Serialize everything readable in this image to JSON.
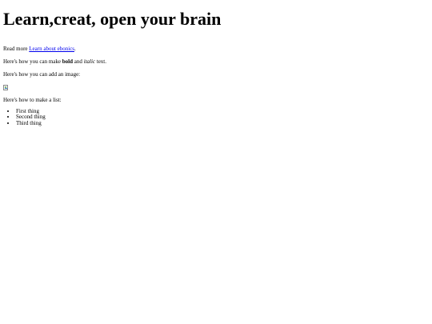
{
  "heading": "Learn,creat, open your brain",
  "read_more": {
    "prefix": "Read more ",
    "link_text": "Learn about ebonics",
    "suffix": "."
  },
  "formatting": {
    "prefix": "Here's how you can make ",
    "bold": "bold",
    "middle": " and ",
    "italic": "italic",
    "suffix": " text."
  },
  "image_intro": "Here's how you can add an image:",
  "list_intro": "Here's how to make a list:",
  "list_items": [
    "First thing",
    "Second thing",
    "Third thing"
  ]
}
